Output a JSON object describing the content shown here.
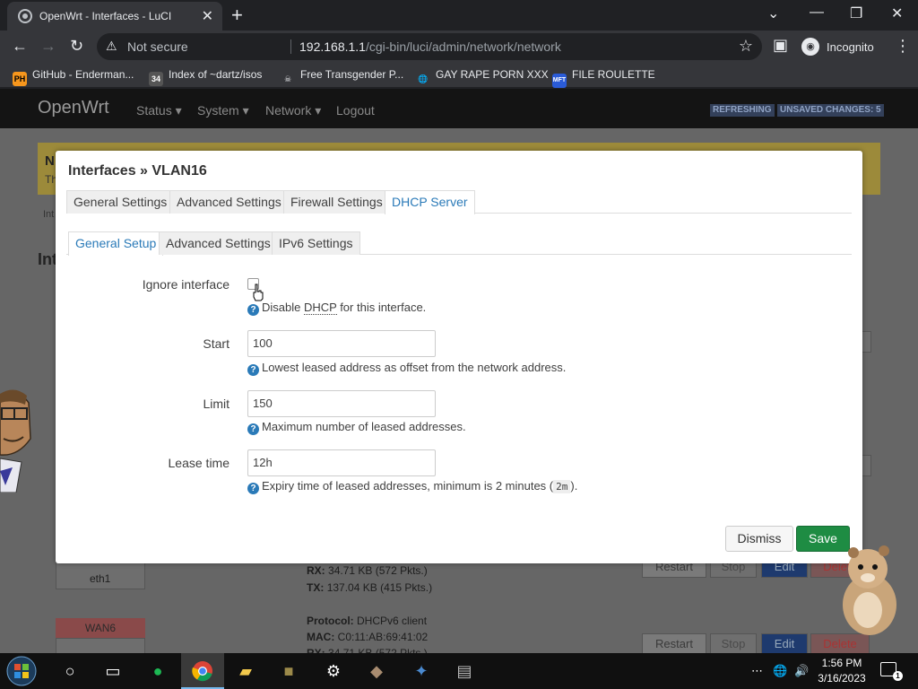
{
  "browser": {
    "tab_title": "OpenWrt - Interfaces - LuCI",
    "tab_close": "✕",
    "new_tab": "+",
    "window_controls": {
      "minimize": "—",
      "maximize": "❐",
      "close": "✕",
      "dropdown": "⌄"
    },
    "url_host": "192.168.1.1",
    "url_path": "/cgi-bin/luci/admin/network/network",
    "security_label": "Not secure",
    "profile_label": "Incognito",
    "bookmarks": [
      {
        "label": "GitHub - Enderman...",
        "icon": "PH",
        "color": "#f7971d"
      },
      {
        "label": "Index of ~dartz/isos",
        "icon": "34",
        "color": "#555555"
      },
      {
        "label": "Free Transgender P...",
        "icon": "☠",
        "color": "#35363a"
      },
      {
        "label": "GAY RAPE PORN XXX",
        "icon": "🌐",
        "color": "#35363a"
      },
      {
        "label": "FILE ROULETTE",
        "icon": "MFT",
        "color": "#2a5bd7"
      }
    ]
  },
  "luci": {
    "brand": "OpenWrt",
    "nav": [
      "Status ▾",
      "System ▾",
      "Network ▾",
      "Logout"
    ],
    "badges": [
      "REFRESHING",
      "UNSAVED CHANGES: 5"
    ],
    "bg_notice_title": "N",
    "bg_notice_text": "Th",
    "bg_crumb": "Int",
    "bg_heading": "Int",
    "bg_rx": "RX:",
    "bg_rx_val": "34.71 KB (572 Pkts.)",
    "bg_tx": "TX:",
    "bg_tx_val": "137.04 KB (415 Pkts.)",
    "bg_eth1": "eth1",
    "bg_wan6": "WAN6",
    "bg_protocol": "Protocol:",
    "bg_protocol_val": "DHCPv6 client",
    "bg_mac": "MAC:",
    "bg_mac_val": "C0:11:AB:69:41:02",
    "bg_rx2": "RX:",
    "bg_rx2_val": "34.71 KB (572 Pkts.)",
    "bg_buttons": [
      "Restart",
      "Stop",
      "Edit",
      "Delete"
    ]
  },
  "modal": {
    "title": "Interfaces » VLAN16",
    "main_tabs": [
      "General Settings",
      "Advanced Settings",
      "Firewall Settings",
      "DHCP Server"
    ],
    "sub_tabs": [
      "General Setup",
      "Advanced Settings",
      "IPv6 Settings"
    ],
    "ignore_interface": {
      "label": "Ignore interface",
      "help_pre": "Disable ",
      "help_abbr": "DHCP",
      "help_post": " for this interface."
    },
    "start": {
      "label": "Start",
      "value": "100",
      "help": "Lowest leased address as offset from the network address."
    },
    "limit": {
      "label": "Limit",
      "value": "150",
      "help": "Maximum number of leased addresses."
    },
    "lease_time": {
      "label": "Lease time",
      "value": "12h",
      "help_pre": "Expiry time of leased addresses, minimum is 2 minutes (",
      "help_code": "2m",
      "help_post": ")."
    },
    "dismiss_label": "Dismiss",
    "save_label": "Save",
    "help_glyph": "?"
  },
  "taskbar": {
    "time": "1:56 PM",
    "date": "3/16/2023",
    "notification_count": "1",
    "overflow": "⋯"
  }
}
